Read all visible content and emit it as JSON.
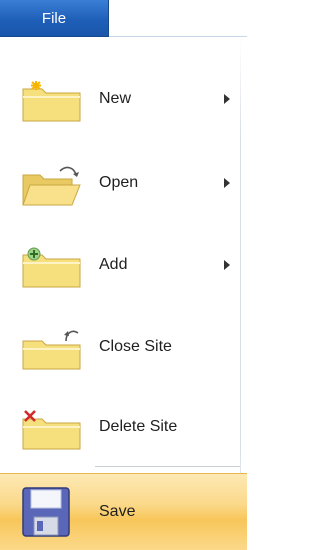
{
  "menu": {
    "file_tab_label": "File",
    "items": [
      {
        "label": "New",
        "icon": "new-folder-icon",
        "has_submenu": true
      },
      {
        "label": "Open",
        "icon": "open-folder-icon",
        "has_submenu": true
      },
      {
        "label": "Add",
        "icon": "add-folder-icon",
        "has_submenu": true
      },
      {
        "label": "Close Site",
        "icon": "close-folder-icon",
        "has_submenu": false
      },
      {
        "label": "Delete Site",
        "icon": "delete-folder-icon",
        "has_submenu": false
      }
    ],
    "save": {
      "label": "Save",
      "icon": "floppy-disk-icon",
      "highlighted": true
    }
  },
  "colors": {
    "tab_blue": "#1f5fb8",
    "folder_yellow": "#f6df7d",
    "highlight_orange": "#f8c65a"
  }
}
